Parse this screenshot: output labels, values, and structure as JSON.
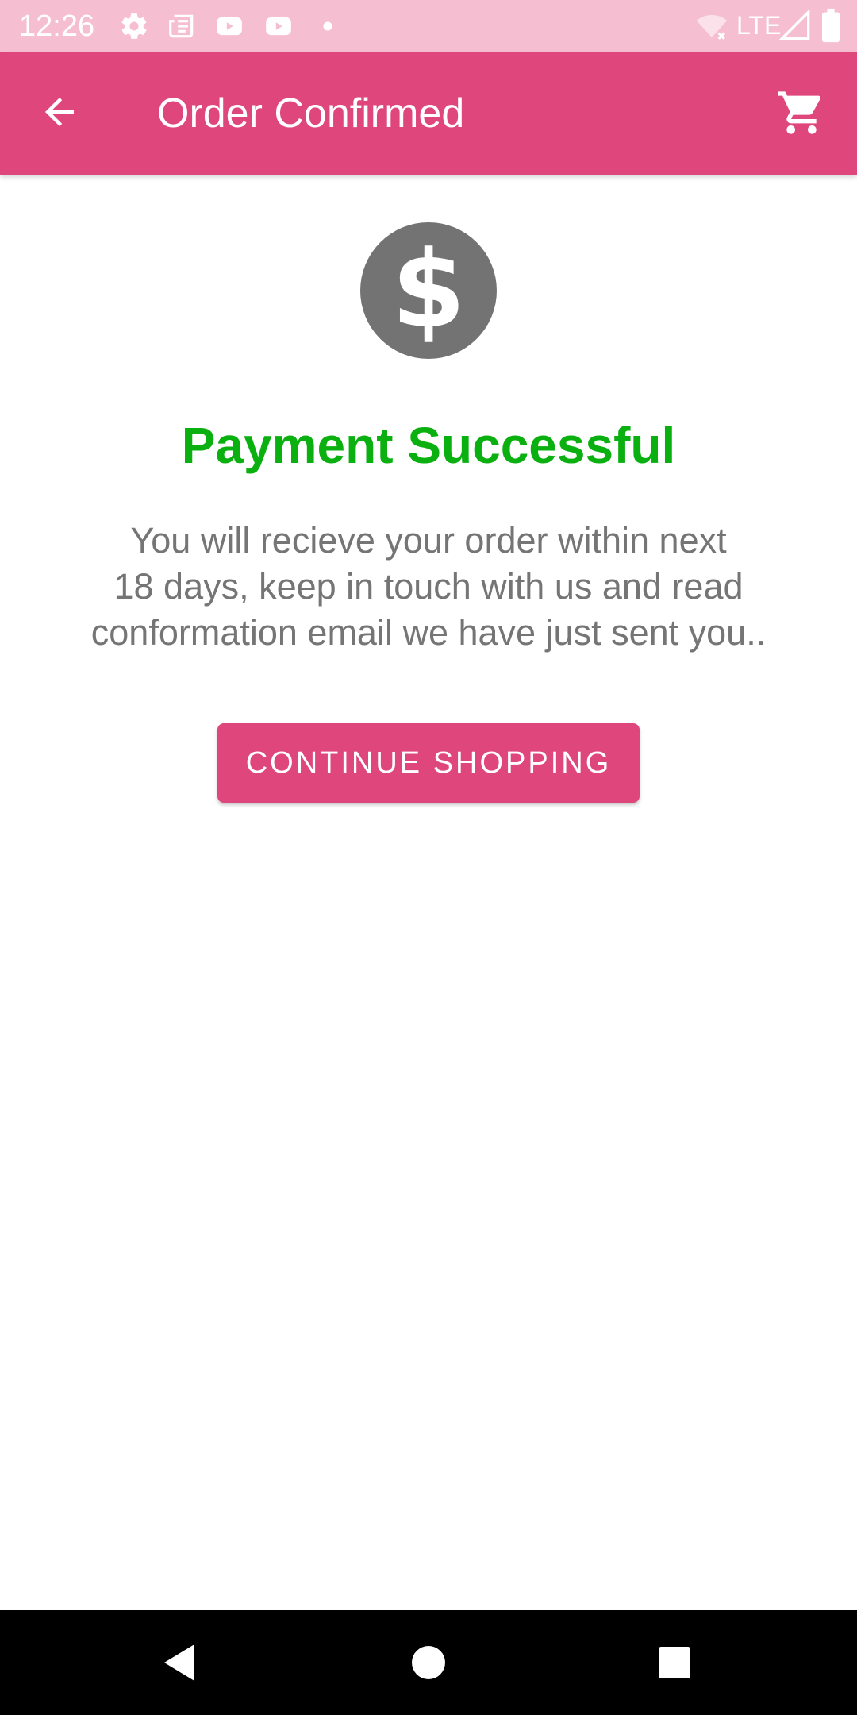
{
  "status_bar": {
    "time": "12:26",
    "network": "LTE",
    "icons": [
      "settings-icon",
      "news-icon",
      "youtube-icon",
      "youtube-icon",
      "dot-icon",
      "wifi-off-icon",
      "signal-icon",
      "battery-icon"
    ],
    "color": "#f6bfd1"
  },
  "app_bar": {
    "title": "Order Confirmed",
    "back_icon": "arrow-back-icon",
    "cart_icon": "shopping-cart-icon",
    "color": "#df467b"
  },
  "content": {
    "icon": "dollar-circle-icon",
    "headline": "Payment Successful",
    "headline_color": "#0aaf10",
    "message_lines": [
      "You will recieve your order within next",
      "18 days, keep in touch with us and read",
      "conformation email we have just sent you.."
    ],
    "button_label": "CONTINUE SHOPPING",
    "button_color": "#df467b"
  },
  "nav_bar": {
    "buttons": [
      "back-icon",
      "home-icon",
      "recents-icon"
    ]
  }
}
